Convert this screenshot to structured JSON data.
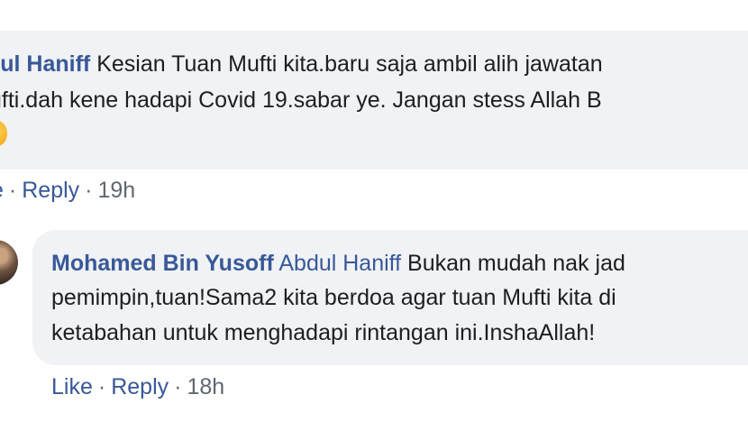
{
  "comment_top": {
    "author_visible": "dul Haniff",
    "line1_text": " Kesian Tuan Mufti kita.baru saja ambil alih jawatan",
    "line2_text": "ufti.dah kene hadapi Covid 19.sabar ye. Jangan stess Allah B",
    "actions": {
      "like_label": "e",
      "reply_label": "Reply",
      "separator": "·",
      "timestamp": "19h"
    }
  },
  "comment_reply": {
    "author": "Mohamed Bin Yusoff",
    "mention": "Abdul Haniff",
    "line1_text": " Bukan mudah nak jad",
    "line2_text": "pemimpin,tuan!Sama2 kita berdoa agar tuan Mufti kita di",
    "line3_text": "ketabahan untuk menghadapi rintangan ini.InshaAllah!",
    "actions": {
      "like_label": "Like",
      "reply_label": "Reply",
      "separator": "·",
      "timestamp": "18h"
    }
  },
  "icons": {
    "emoji": "emoji-icon",
    "avatar": "user-avatar"
  },
  "colors": {
    "link_blue": "#385898",
    "bubble_bg": "#f0f2f5",
    "text": "#1c1e21",
    "meta_gray": "#606770"
  }
}
